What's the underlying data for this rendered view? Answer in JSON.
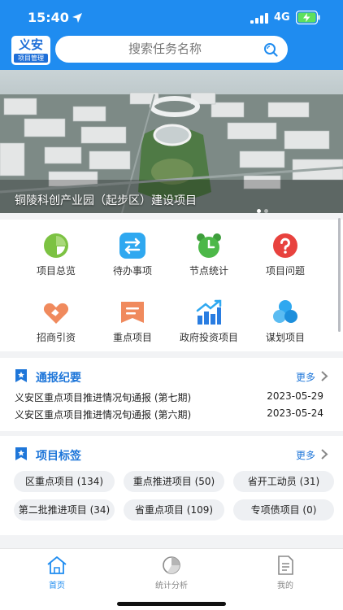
{
  "status_bar": {
    "time": "15:40",
    "network": "4G"
  },
  "logo": {
    "main": "义安",
    "sub": "项目管理"
  },
  "search": {
    "placeholder": "搜索任务名称"
  },
  "banner": {
    "caption": "铜陵科创产业园（起步区）建设项目",
    "dots": 2,
    "active_dot": 0
  },
  "menu": {
    "items": [
      {
        "label": "项目总览",
        "icon": "pie-chart-icon",
        "color": "#7cc242"
      },
      {
        "label": "待办事项",
        "icon": "swap-arrows-icon",
        "color": "#2fa8f0"
      },
      {
        "label": "节点统计",
        "icon": "alarm-clock-icon",
        "color": "#4cb848"
      },
      {
        "label": "项目问题",
        "icon": "question-icon",
        "color": "#e8423e"
      },
      {
        "label": "招商引资",
        "icon": "handshake-icon",
        "color": "#f08a5d"
      },
      {
        "label": "重点项目",
        "icon": "key-project-icon",
        "color": "#f08a5d"
      },
      {
        "label": "政府投资项目",
        "icon": "bar-growth-icon",
        "color": "#2a7de1"
      },
      {
        "label": "谋划项目",
        "icon": "clover-icon",
        "color": "#2fa8f0"
      }
    ]
  },
  "reports": {
    "title": "通报纪要",
    "more": "更多",
    "items": [
      {
        "title": "义安区重点项目推进情况旬通报 (第七期)",
        "date": "2023-05-29"
      },
      {
        "title": "义安区重点项目推进情况旬通报 (第六期)",
        "date": "2023-05-24"
      }
    ]
  },
  "tags": {
    "title": "项目标签",
    "more": "更多",
    "items": [
      {
        "label": "区重点项目 (134)"
      },
      {
        "label": "重点推进项目 (50)"
      },
      {
        "label": "省开工动员 (31)"
      },
      {
        "label": "第二批推进项目 (34)"
      },
      {
        "label": "省重点项目 (109)"
      },
      {
        "label": "专项债项目 (0)"
      }
    ]
  },
  "tabbar": {
    "items": [
      {
        "label": "首页",
        "icon": "home-icon",
        "active": true
      },
      {
        "label": "统计分析",
        "icon": "statistics-icon",
        "active": false
      },
      {
        "label": "我的",
        "icon": "profile-document-icon",
        "active": false
      }
    ]
  },
  "colors": {
    "brand": "#1f8cf0",
    "accent_text": "#1e76d9",
    "tag_bg": "#eef0f3"
  }
}
